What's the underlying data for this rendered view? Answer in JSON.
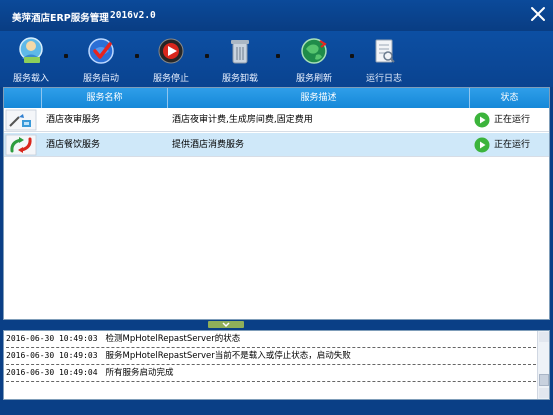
{
  "window": {
    "title": "美萍酒店ERP服务管理",
    "version": "2016v2.0",
    "close_icon": "close-icon"
  },
  "toolbar": {
    "items": [
      {
        "label": "服务载入",
        "icon": "load-service-icon"
      },
      {
        "label": "服务启动",
        "icon": "start-service-icon"
      },
      {
        "label": "服务停止",
        "icon": "stop-service-icon"
      },
      {
        "label": "服务卸载",
        "icon": "uninstall-service-icon"
      },
      {
        "label": "服务刷新",
        "icon": "refresh-service-icon"
      },
      {
        "label": "运行日志",
        "icon": "run-log-icon"
      }
    ]
  },
  "grid": {
    "columns": [
      "",
      "服务名称",
      "服务描述",
      "状态"
    ],
    "rows": [
      {
        "name": "酒店夜审服务",
        "description": "酒店夜审计费,生成房间费,固定费用",
        "status": "正在运行",
        "icon": "night-audit-icon",
        "selected": false
      },
      {
        "name": "酒店餐饮服务",
        "description": "提供酒店消费服务",
        "status": "正在运行",
        "icon": "catering-icon",
        "selected": true
      }
    ]
  },
  "log": {
    "entries": [
      {
        "time": "2016-06-30 10:49:03",
        "message": "检测MpHotelRepastServer的状态"
      },
      {
        "time": "2016-06-30 10:49:03",
        "message": "服务MpHotelRepastServer当前不是载入或停止状态，启动失败"
      },
      {
        "time": "2016-06-30 10:49:04",
        "message": "所有服务启动完成"
      }
    ]
  },
  "colors": {
    "window_bg": "#0a3f86",
    "header_bg": "#1588d8",
    "selected_row": "#cfe8f9",
    "status_green": "#3cb43c"
  }
}
